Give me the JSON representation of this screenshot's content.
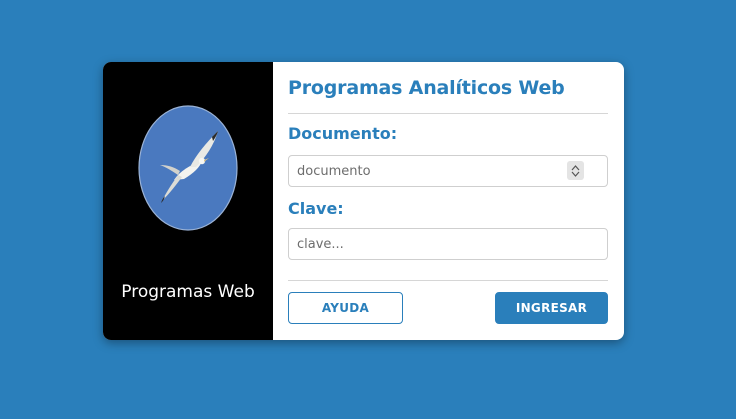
{
  "brand": {
    "app_name": "Programas Web",
    "logo_icon": "albatross-logo-icon"
  },
  "form": {
    "title": "Programas Analíticos Web",
    "documento": {
      "label": "Documento:",
      "placeholder": "documento",
      "value": ""
    },
    "clave": {
      "label": "Clave:",
      "placeholder": "clave...",
      "value": ""
    },
    "help_label": "AYUDA",
    "submit_label": "INGRESAR"
  },
  "colors": {
    "background": "#2a7fbb",
    "accent": "#2a7fbb",
    "sidebar": "#000000",
    "logo_fill": "#4a79bf"
  }
}
